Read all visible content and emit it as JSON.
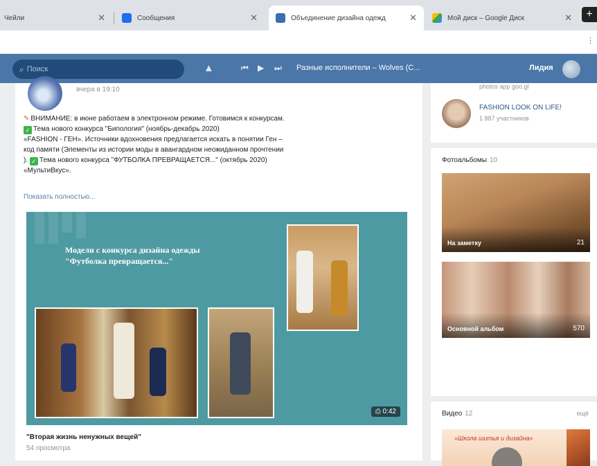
{
  "browser": {
    "tabs": [
      {
        "title": "Чейли",
        "close": "✕"
      },
      {
        "title": "Сообщения",
        "close": "✕"
      },
      {
        "title": "Объединение дизайна одежд",
        "close": "✕"
      },
      {
        "title": "Мой диск – Google Диск",
        "close": "✕"
      }
    ],
    "new_tab": "+",
    "menu": "⋮"
  },
  "header": {
    "search_placeholder": "Поиск",
    "player_track": "Разные исполнители – Wolves (C...",
    "user_name": "Лидия",
    "icons": {
      "search": "⌕",
      "bell": "▲",
      "prev": "⏮",
      "play": "▶",
      "next": "⏭"
    }
  },
  "post": {
    "date": "вчера в 19:10",
    "lines": [
      "ВНИМАНИЕ: в июне работаем в электронном режиме. Готовимся к конкурсам.",
      "Тема нового конкурса \"Бипология\" (ноябрь-декабрь 2020)",
      "«FASHION - ГЕН». Источники вдохновения предлагается искать в понятии Ген –",
      "код памяти (Элементы из истории моды в авангардном неожиданном прочтении",
      "Тема нового конкурса \"ФУТБОЛКА ПРЕВРАЩАЕТСЯ...\" (октябрь 2020)",
      "«МультиВкус»."
    ],
    "line5_prefix": "). ",
    "show_more": "Показать полностью...",
    "video_title_1": "Модели с конкурса дизайна одежды",
    "video_title_2": "\"Футболка превращается...\"",
    "duration": "⎙ 0:42",
    "title": "\"Вторая жизнь ненужных вещей\"",
    "views": "54 просмотра"
  },
  "sidebar": {
    "groups_sub": "photos app goo.gl",
    "group_name": "FASHION LOOK ON LIFE!",
    "group_members": "1 887 участников",
    "albums_label": "Фотоальбомы",
    "albums_count": "10",
    "albums": [
      {
        "name": "На заметку",
        "count": "21"
      },
      {
        "name": "Основной альбом",
        "count": "570"
      }
    ],
    "video_label": "Видео",
    "video_count": "12",
    "video_all": "ещё",
    "video_thumb_text": "«Школа шитья и дизайна»"
  }
}
